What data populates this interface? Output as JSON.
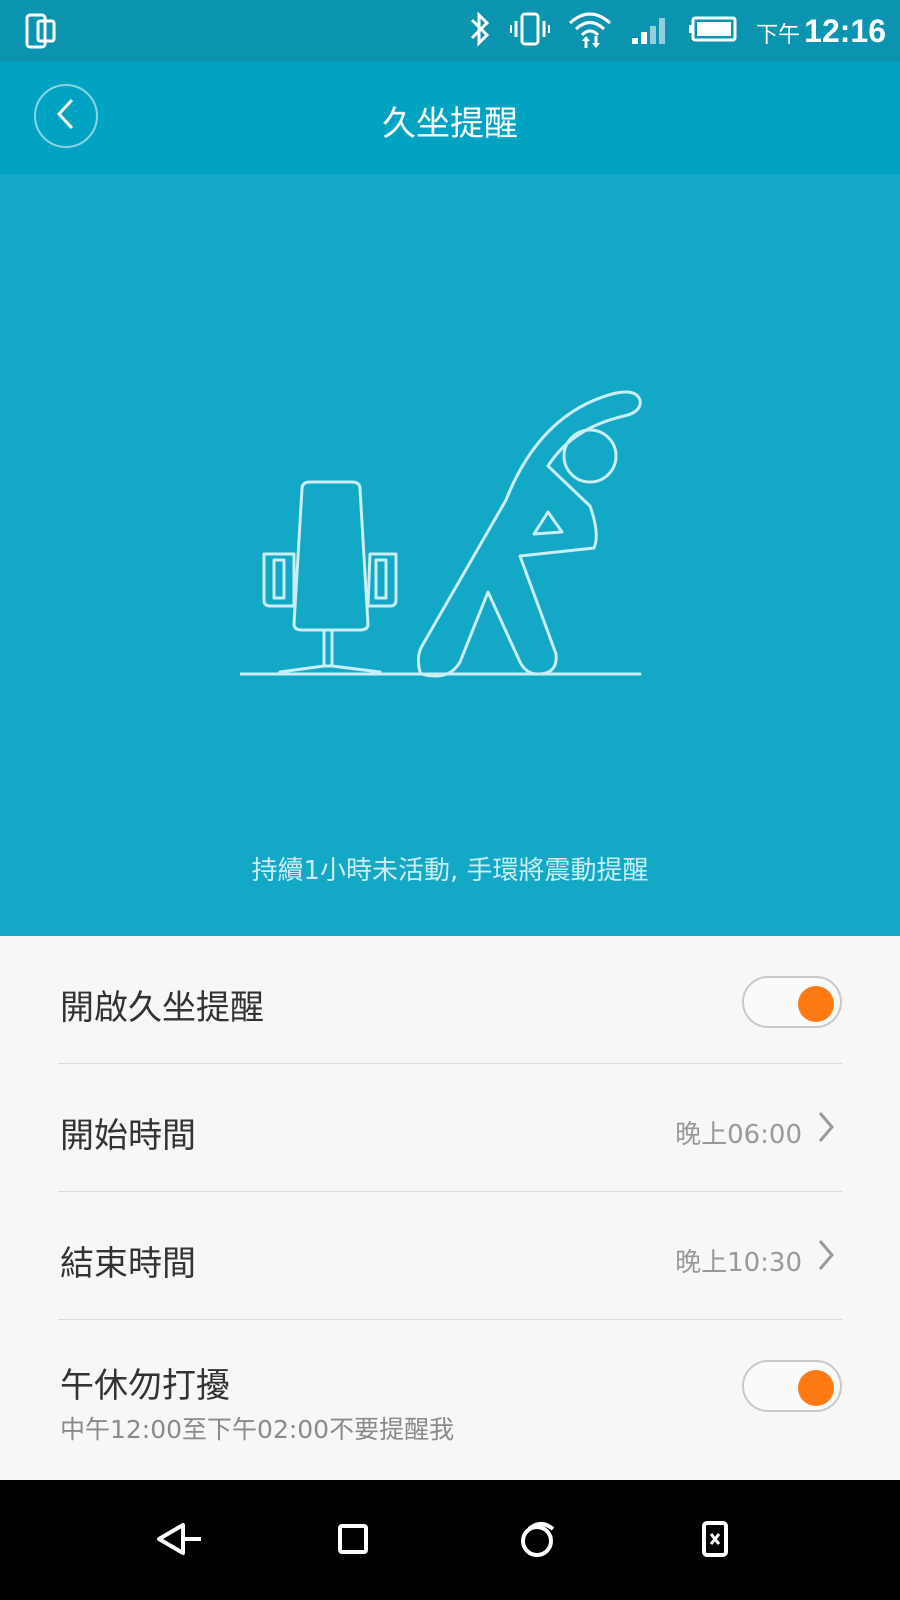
{
  "status_bar": {
    "ampm": "下午",
    "time": "12:16",
    "icons": [
      "phone-screen-icon",
      "bluetooth-icon",
      "vibrate-icon",
      "wifi-icon",
      "signal-icon",
      "battery-icon"
    ]
  },
  "app_bar": {
    "title": "久坐提醒",
    "back_icon": "chevron-left-icon"
  },
  "hero": {
    "caption": "持續1小時未活動, 手環將震動提醒",
    "illustration": "chair-and-stretching-person"
  },
  "settings": {
    "enable": {
      "label": "開啟久坐提醒",
      "on": true
    },
    "start_time": {
      "label": "開始時間",
      "value": "晚上06:00"
    },
    "end_time": {
      "label": "結束時間",
      "value": "晚上10:30"
    },
    "nap_dnd": {
      "label": "午休勿打擾",
      "sub": "中午12:00至下午02:00不要提醒我",
      "on": true
    }
  },
  "colors": {
    "status_bar": "#0a94b0",
    "app_bar": "#00a4c2",
    "hero": "#13a8c6",
    "toggle_on": "#ff7a14"
  },
  "nav_bar": {
    "icons": [
      "back-triangle-icon",
      "home-square-icon",
      "recents-circle-icon",
      "app-switch-icon"
    ]
  }
}
